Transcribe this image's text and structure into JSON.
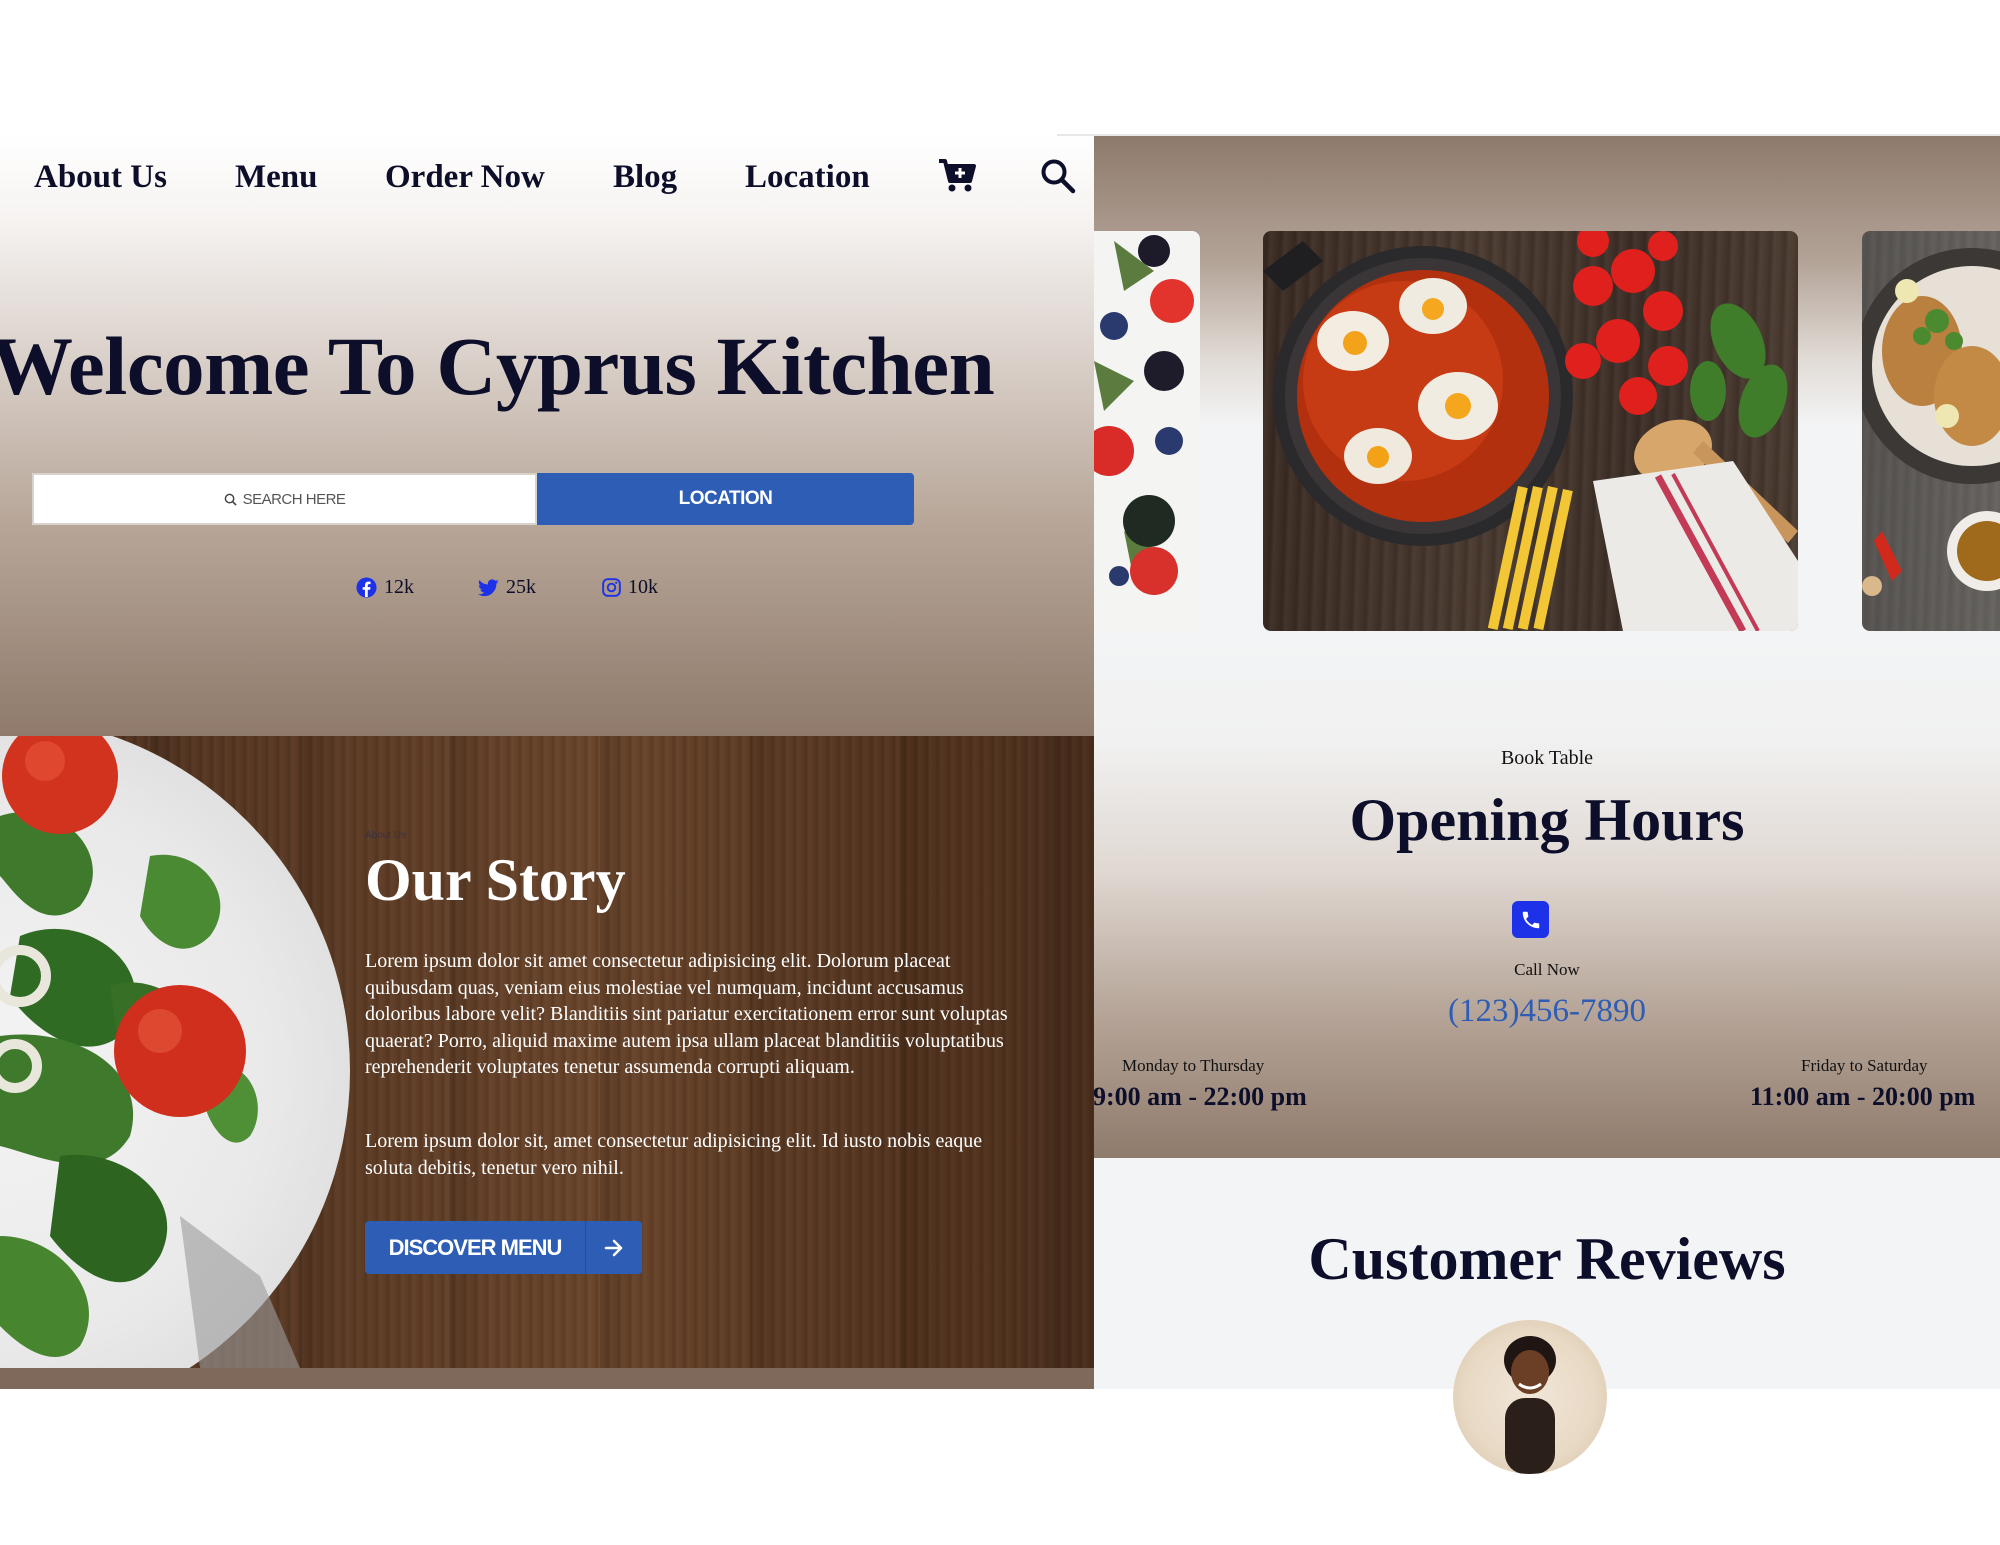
{
  "nav": {
    "items": [
      "About Us",
      "Menu",
      "Order Now",
      "Blog",
      "Location"
    ],
    "cart_icon": "cart-plus-icon",
    "search_icon": "search-icon"
  },
  "hero": {
    "title": "Welcome To Cyprus Kitchen",
    "search_placeholder": "SEARCH HERE",
    "location_button": "LOCATION",
    "social": [
      {
        "icon": "facebook-icon",
        "count": "12k"
      },
      {
        "icon": "twitter-icon",
        "count": "25k"
      },
      {
        "icon": "instagram-icon",
        "count": "10k"
      }
    ]
  },
  "story": {
    "eyebrow": "About Us",
    "title": "Our Story",
    "paragraph1": "Lorem ipsum dolor sit amet consectetur adipisicing elit. Dolorum placeat quibusdam quas, veniam eius molestiae vel numquam, incidunt accusamus doloribus labore velit? Blanditiis sint pariatur exercitationem error sunt voluptas quaerat? Porro, aliquid maxime autem ipsa ullam placeat blanditiis voluptatibus reprehenderit voluptates tenetur assumenda corrupti aliquam.",
    "paragraph2": "Lorem ipsum dolor sit, amet consectetur adipisicing elit. Id iusto nobis eaque soluta debitis, tenetur vero nihil.",
    "button_label": "DISCOVER MENU",
    "button_icon": "arrow-right-icon"
  },
  "hours": {
    "eyebrow": "Book Table",
    "title": "Opening Hours",
    "phone_icon": "phone-icon",
    "call_label": "Call Now",
    "phone": "(123)456-7890",
    "schedule": [
      {
        "days": "Monday to Thursday",
        "time": "9:00 am - 22:00 pm"
      },
      {
        "days": "Friday to Saturday",
        "time": "11:00 am - 20:00 pm"
      }
    ]
  },
  "reviews": {
    "title": "Customer Reviews"
  },
  "colors": {
    "primary": "#2e5db5",
    "heading": "#0d0e2a",
    "phone_icon_bg": "#1c31e8",
    "social_icon": "#1c31e8"
  }
}
